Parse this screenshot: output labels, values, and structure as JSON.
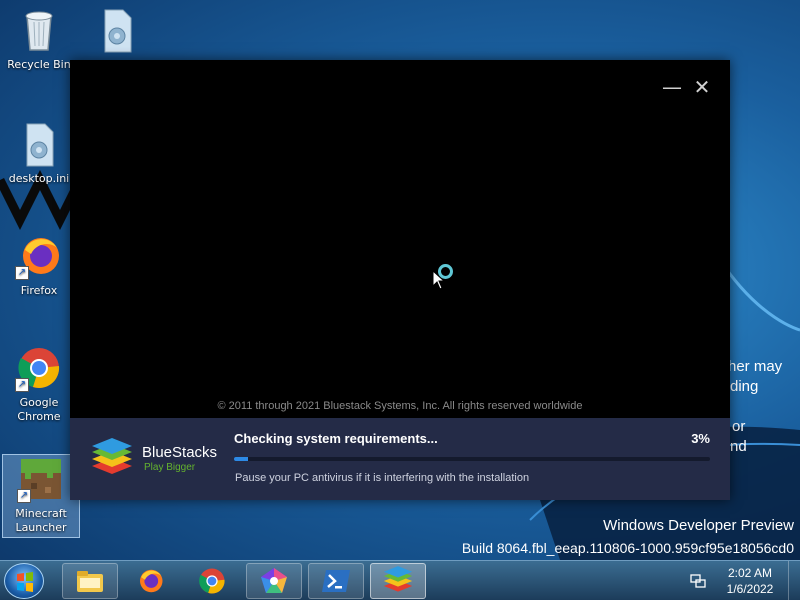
{
  "desktop": {
    "icons": [
      {
        "label": "Recycle Bin",
        "icon": "recycle-bin-icon"
      },
      {
        "label": "",
        "icon": "settings-file-icon"
      },
      {
        "label": "desktop.ini",
        "icon": "settings-file-icon"
      },
      {
        "label": "Firefox",
        "icon": "firefox-icon"
      },
      {
        "label": "Google Chrome",
        "icon": "chrome-icon"
      },
      {
        "label": "Minecraft Launcher",
        "icon": "minecraft-icon"
      }
    ],
    "background_text": [
      "her may",
      "ding",
      "or",
      "nd"
    ],
    "watermark": {
      "line1": "Windows Developer Preview",
      "line2": "Build 8064.fbl_eeap.110806-1000.959cf95e18056cd0"
    }
  },
  "installer": {
    "minimize_glyph": "—",
    "close_glyph": "✕",
    "copyright": "© 2011 through 2021 Bluestack Systems, Inc. All rights reserved worldwide",
    "brand": {
      "name": "BlueStacks",
      "tagline": "Play Bigger"
    },
    "status": {
      "title": "Checking system requirements...",
      "percent_label": "3%",
      "progress": 0.03,
      "hint": "Pause your PC antivirus if it is interfering with the installation"
    },
    "colors": {
      "panel": "#242b47",
      "progress": "#2d8ae6",
      "tagline": "#64b32e"
    }
  },
  "taskbar": {
    "items": [
      {
        "name": "file-explorer-icon",
        "state": "pinned"
      },
      {
        "name": "firefox-icon",
        "state": "none"
      },
      {
        "name": "chrome-icon",
        "state": "none"
      },
      {
        "name": "pentagon-app-icon",
        "state": "pinned"
      },
      {
        "name": "powershell-icon",
        "state": "pinned"
      },
      {
        "name": "bluestacks-icon",
        "state": "active"
      }
    ],
    "clock": {
      "time": "2:02 AM",
      "date": "1/6/2022"
    }
  }
}
